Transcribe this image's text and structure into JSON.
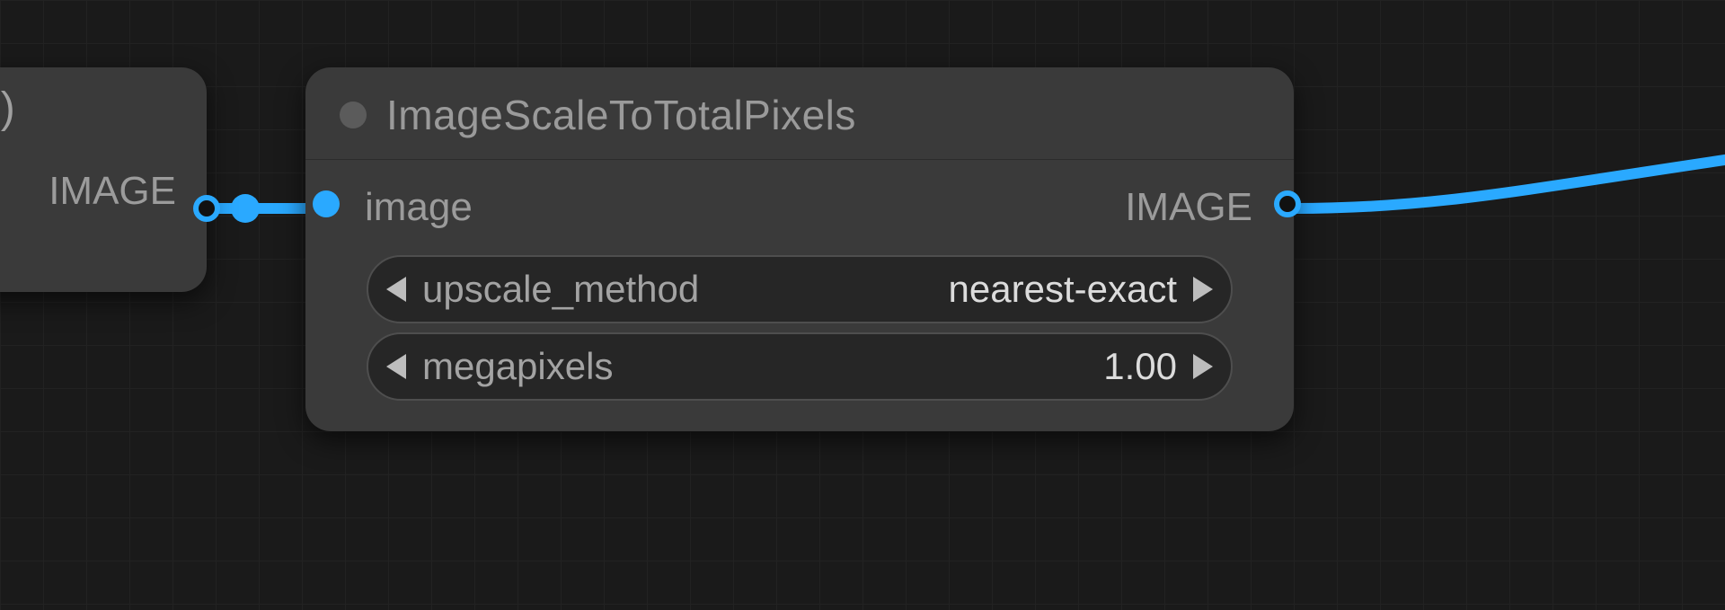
{
  "nodes": {
    "left_node": {
      "title_fragment": "Model)",
      "outputs": [
        {
          "label": "IMAGE"
        }
      ]
    },
    "right_node": {
      "title": "ImageScaleToTotalPixels",
      "inputs": [
        {
          "label": "image"
        }
      ],
      "outputs": [
        {
          "label": "IMAGE"
        }
      ],
      "widgets": [
        {
          "name": "upscale_method",
          "value": "nearest-exact"
        },
        {
          "name": "megapixels",
          "value": "1.00"
        }
      ]
    }
  },
  "links": {
    "accent_color": "#2aa9ff"
  }
}
